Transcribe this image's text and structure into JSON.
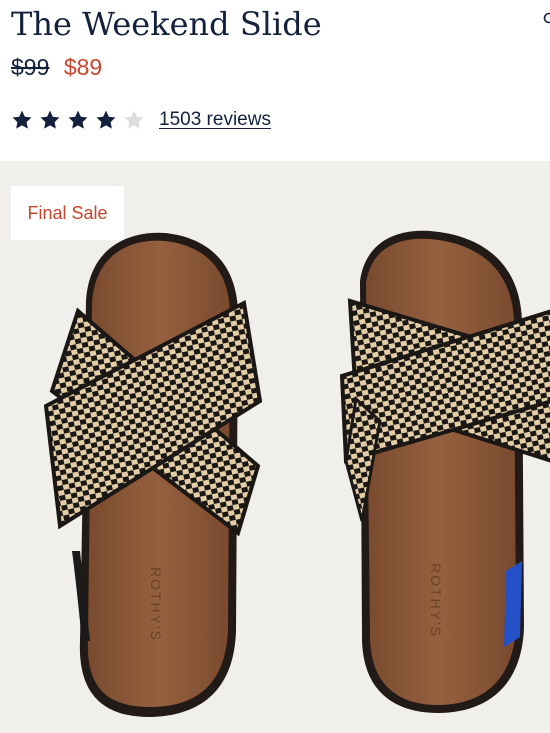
{
  "product": {
    "title": "The Weekend Slide",
    "price_original": "$99",
    "price_sale": "$89",
    "rating_value": 4,
    "rating_max": 5,
    "reviews_link": "1503 reviews",
    "sole_brand_mark": "ROTHY'S"
  },
  "hero": {
    "badge": "Final Sale",
    "image_subject": "pair-of-crossover-slide-sandals"
  },
  "colors": {
    "navy": "#14213d",
    "sale_red": "#c8442f",
    "star_empty": "#dcdcdc",
    "hero_background": "#f0efec",
    "footbed_brown": "#8e5a3c",
    "strap_tan": "#e2cda7",
    "strap_black": "#1b1714"
  },
  "icons": {
    "star": "star-icon",
    "edge": "search-icon"
  }
}
